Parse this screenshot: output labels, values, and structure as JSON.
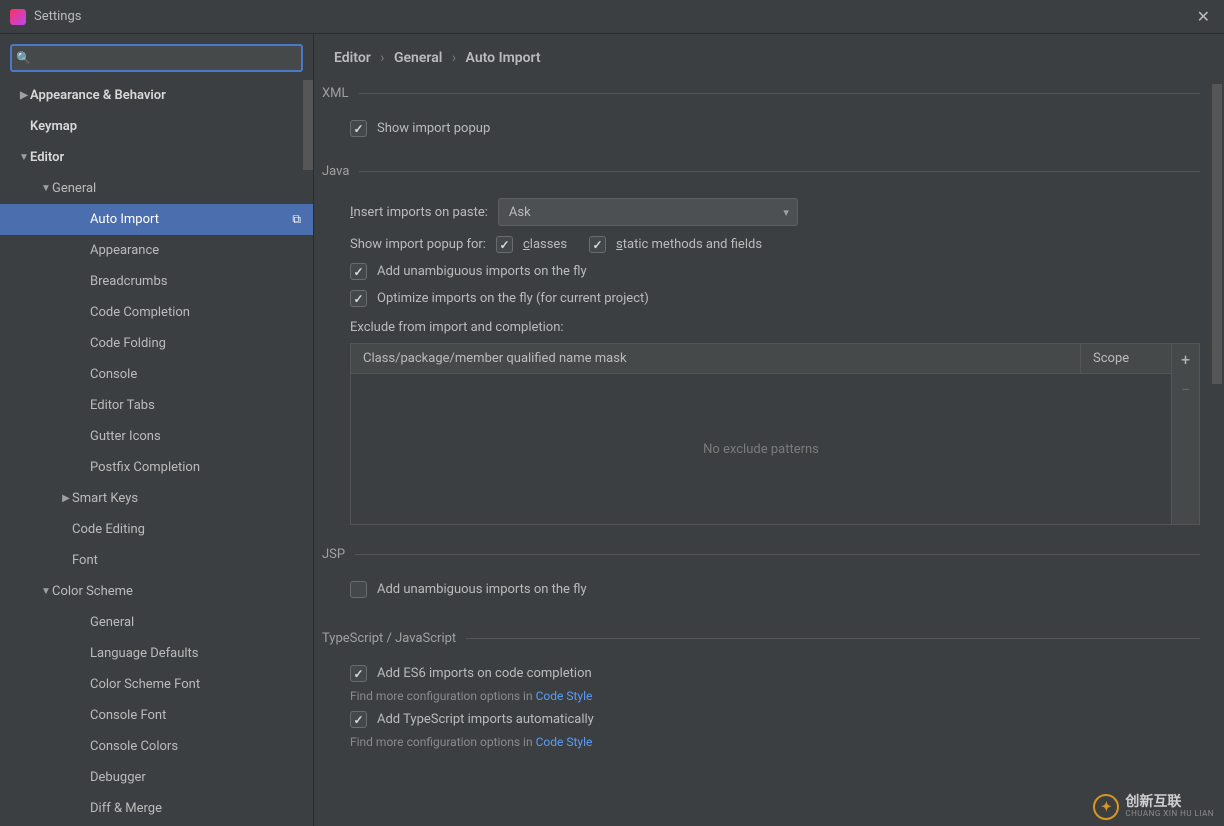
{
  "window": {
    "title": "Settings"
  },
  "search": {
    "placeholder": ""
  },
  "sidebar": {
    "items": [
      {
        "label": "Appearance & Behavior",
        "level": 1,
        "arrow": "right",
        "bold": true
      },
      {
        "label": "Keymap",
        "level": 1,
        "arrow": "",
        "bold": true
      },
      {
        "label": "Editor",
        "level": 1,
        "arrow": "down",
        "bold": true
      },
      {
        "label": "General",
        "level": 2,
        "arrow": "down",
        "bold": false
      },
      {
        "label": "Auto Import",
        "level": 4,
        "arrow": "",
        "bold": false,
        "selected": true,
        "badge": true
      },
      {
        "label": "Appearance",
        "level": 4,
        "arrow": "",
        "bold": false
      },
      {
        "label": "Breadcrumbs",
        "level": 4,
        "arrow": "",
        "bold": false
      },
      {
        "label": "Code Completion",
        "level": 4,
        "arrow": "",
        "bold": false
      },
      {
        "label": "Code Folding",
        "level": 4,
        "arrow": "",
        "bold": false
      },
      {
        "label": "Console",
        "level": 4,
        "arrow": "",
        "bold": false
      },
      {
        "label": "Editor Tabs",
        "level": 4,
        "arrow": "",
        "bold": false
      },
      {
        "label": "Gutter Icons",
        "level": 4,
        "arrow": "",
        "bold": false
      },
      {
        "label": "Postfix Completion",
        "level": 4,
        "arrow": "",
        "bold": false
      },
      {
        "label": "Smart Keys",
        "level": 3,
        "arrow": "right",
        "bold": false
      },
      {
        "label": "Code Editing",
        "level": 3,
        "arrow": "",
        "bold": false
      },
      {
        "label": "Font",
        "level": 3,
        "arrow": "",
        "bold": false
      },
      {
        "label": "Color Scheme",
        "level": 2,
        "arrow": "down",
        "bold": false
      },
      {
        "label": "General",
        "level": 4,
        "arrow": "",
        "bold": false
      },
      {
        "label": "Language Defaults",
        "level": 4,
        "arrow": "",
        "bold": false
      },
      {
        "label": "Color Scheme Font",
        "level": 4,
        "arrow": "",
        "bold": false
      },
      {
        "label": "Console Font",
        "level": 4,
        "arrow": "",
        "bold": false
      },
      {
        "label": "Console Colors",
        "level": 4,
        "arrow": "",
        "bold": false
      },
      {
        "label": "Debugger",
        "level": 4,
        "arrow": "",
        "bold": false
      },
      {
        "label": "Diff & Merge",
        "level": 4,
        "arrow": "",
        "bold": false
      }
    ]
  },
  "breadcrumb": {
    "a": "Editor",
    "b": "General",
    "c": "Auto Import"
  },
  "xml": {
    "title": "XML",
    "show_popup": "Show import popup"
  },
  "java": {
    "title": "Java",
    "insert_label_pre": "I",
    "insert_label_post": "nsert imports on paste:",
    "insert_value": "Ask",
    "popup_label": "Show import popup for:",
    "classes_pre": "c",
    "classes_post": "lasses",
    "static_pre": "s",
    "static_post": "tatic methods and fields",
    "unambiguous": "Add unambiguous imports on the fly",
    "optimize": "Optimize imports on the fly (for current project)",
    "exclude_label": "Exclude from import and completion:",
    "th1": "Class/package/member qualified name mask",
    "th2": "Scope",
    "empty": "No exclude patterns"
  },
  "jsp": {
    "title": "JSP",
    "unambiguous": "Add unambiguous imports on the fly"
  },
  "ts": {
    "title": "TypeScript / JavaScript",
    "es6": "Add ES6 imports on code completion",
    "ts_auto": "Add TypeScript imports automatically",
    "hint_prefix": "Find more configuration options in ",
    "hint_link": "Code Style"
  },
  "watermark": {
    "cn": "创新互联",
    "py": "CHUANG XIN HU LIAN"
  }
}
